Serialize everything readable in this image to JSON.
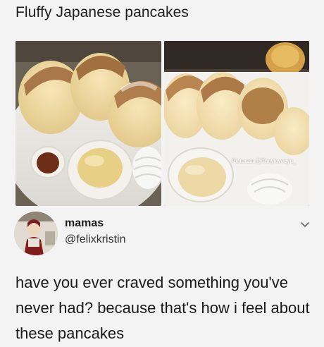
{
  "title": "Fluffy Japanese pancakes",
  "photo_right": {
    "watermark": "Pinterest @Theylovecyn_"
  },
  "tweet": {
    "display_name": "mamas",
    "handle": "@felixkristin",
    "text": "have you ever craved something you've never had? because that's how i feel about these pancakes"
  },
  "icons": {
    "menu": "chevron-down-icon",
    "avatar": "user-photo"
  }
}
